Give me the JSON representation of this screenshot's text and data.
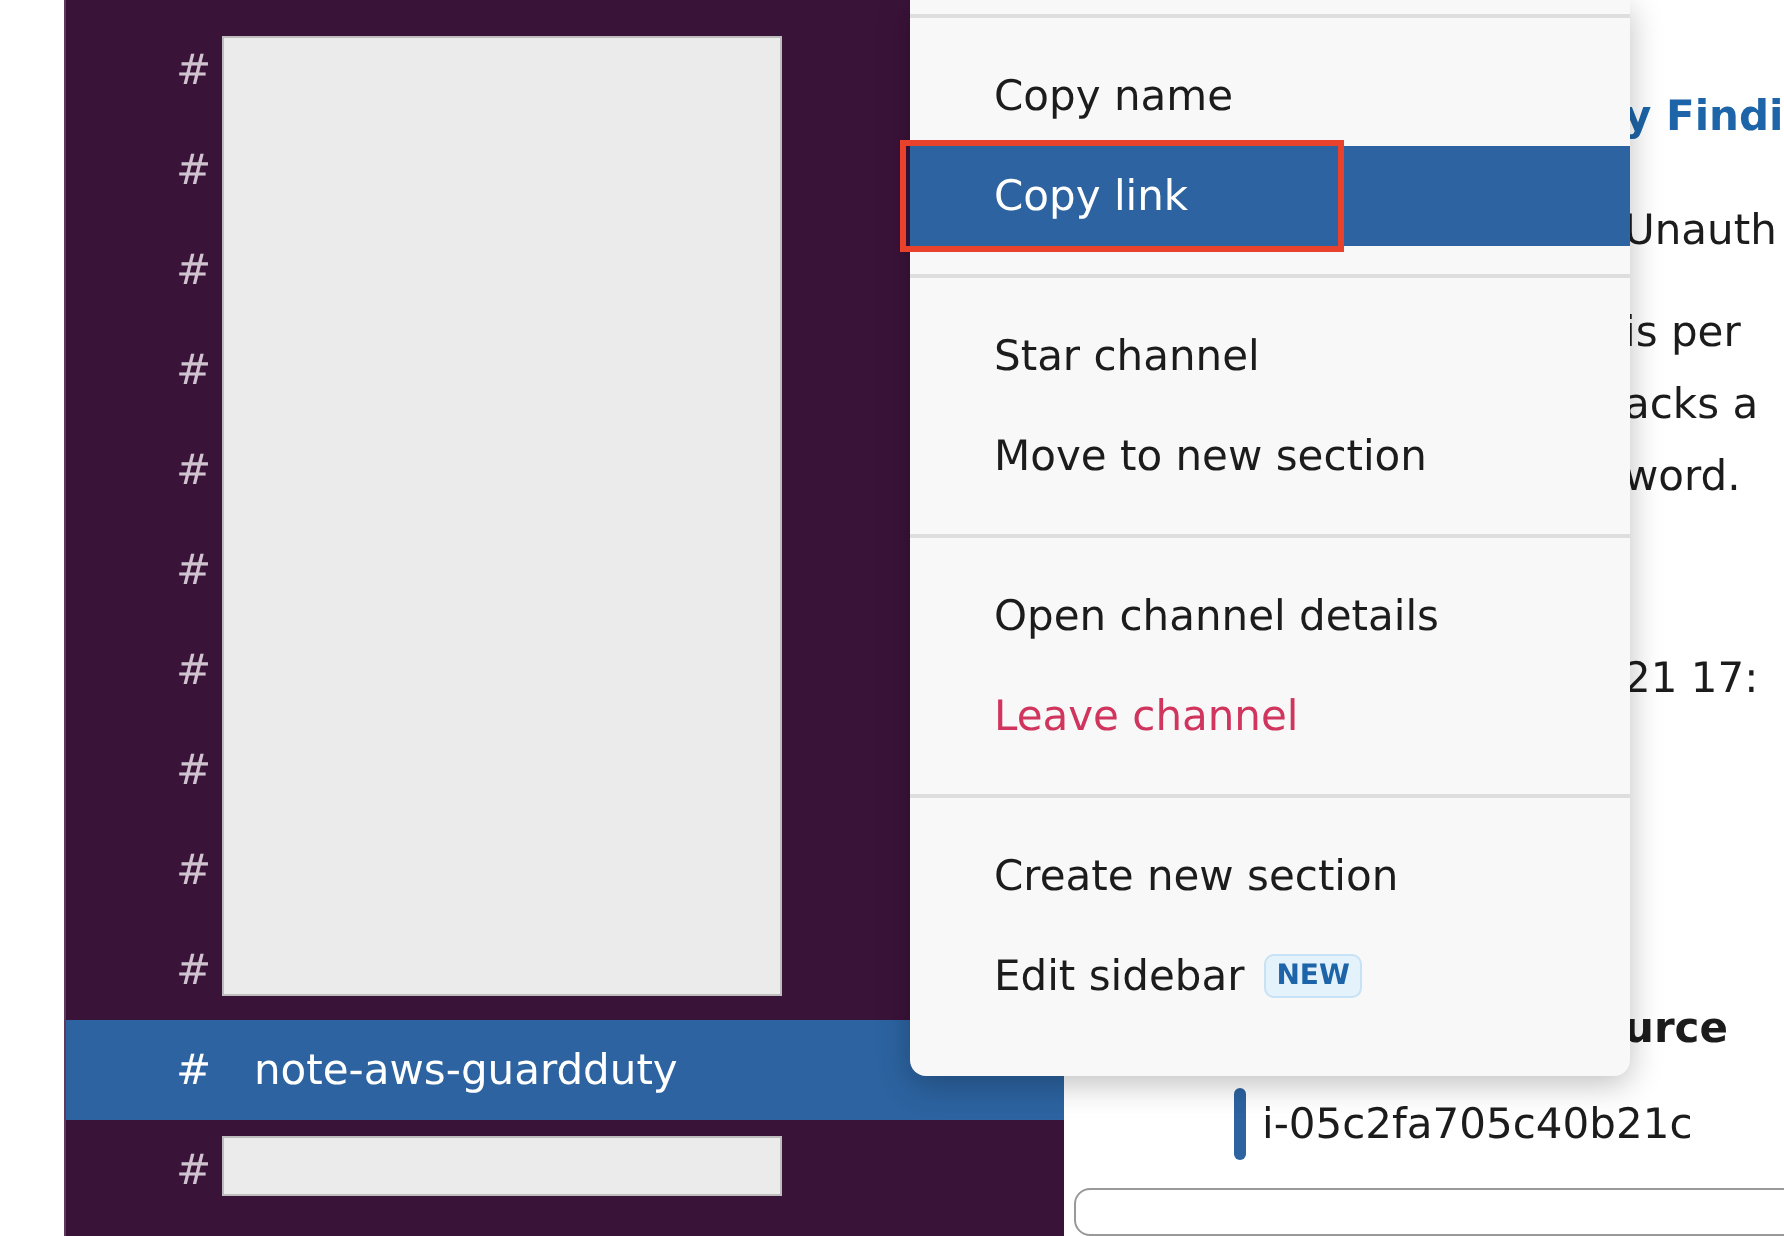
{
  "sidebar": {
    "channels": [
      {
        "hash": "#",
        "kind": "redacted",
        "selected": false
      },
      {
        "hash": "#",
        "kind": "redacted",
        "selected": false
      },
      {
        "hash": "#",
        "kind": "redacted",
        "selected": false
      },
      {
        "hash": "#",
        "kind": "redacted",
        "selected": false
      },
      {
        "hash": "#",
        "kind": "redacted",
        "selected": false
      },
      {
        "hash": "#",
        "kind": "redacted",
        "selected": false
      },
      {
        "hash": "#",
        "kind": "redacted",
        "selected": false
      },
      {
        "hash": "#",
        "kind": "redacted",
        "selected": false
      },
      {
        "hash": "#",
        "kind": "redacted",
        "selected": false
      },
      {
        "hash": "#",
        "kind": "redacted",
        "selected": false
      },
      {
        "hash": "#",
        "kind": "named",
        "name": "note-aws-guardduty",
        "selected": true
      },
      {
        "hash": "#",
        "kind": "redacted",
        "selected": false
      }
    ]
  },
  "message": {
    "title": "y Findi",
    "lines": [
      "Unauth",
      "is per",
      "acks a",
      "word.",
      "21 17:"
    ],
    "field_label": "urce",
    "field_value": "i-05c2fa705c40b21c"
  },
  "context_menu": {
    "sections": [
      {
        "items": [
          {
            "label": "Copy name",
            "kind": "normal",
            "selected": false,
            "annotated": false
          },
          {
            "label": "Copy link",
            "kind": "normal",
            "selected": true,
            "annotated": true
          }
        ]
      },
      {
        "items": [
          {
            "label": "Star channel",
            "kind": "normal",
            "selected": false,
            "annotated": false
          },
          {
            "label": "Move to new section",
            "kind": "normal",
            "selected": false,
            "annotated": false
          }
        ]
      },
      {
        "items": [
          {
            "label": "Open channel details",
            "kind": "normal",
            "selected": false,
            "annotated": false
          },
          {
            "label": "Leave channel",
            "kind": "danger",
            "selected": false,
            "annotated": false
          }
        ]
      },
      {
        "items": [
          {
            "label": "Create new section",
            "kind": "normal",
            "selected": false,
            "annotated": false
          },
          {
            "label": "Edit sidebar",
            "kind": "normal",
            "selected": false,
            "annotated": false,
            "badge": "NEW"
          }
        ]
      }
    ]
  }
}
